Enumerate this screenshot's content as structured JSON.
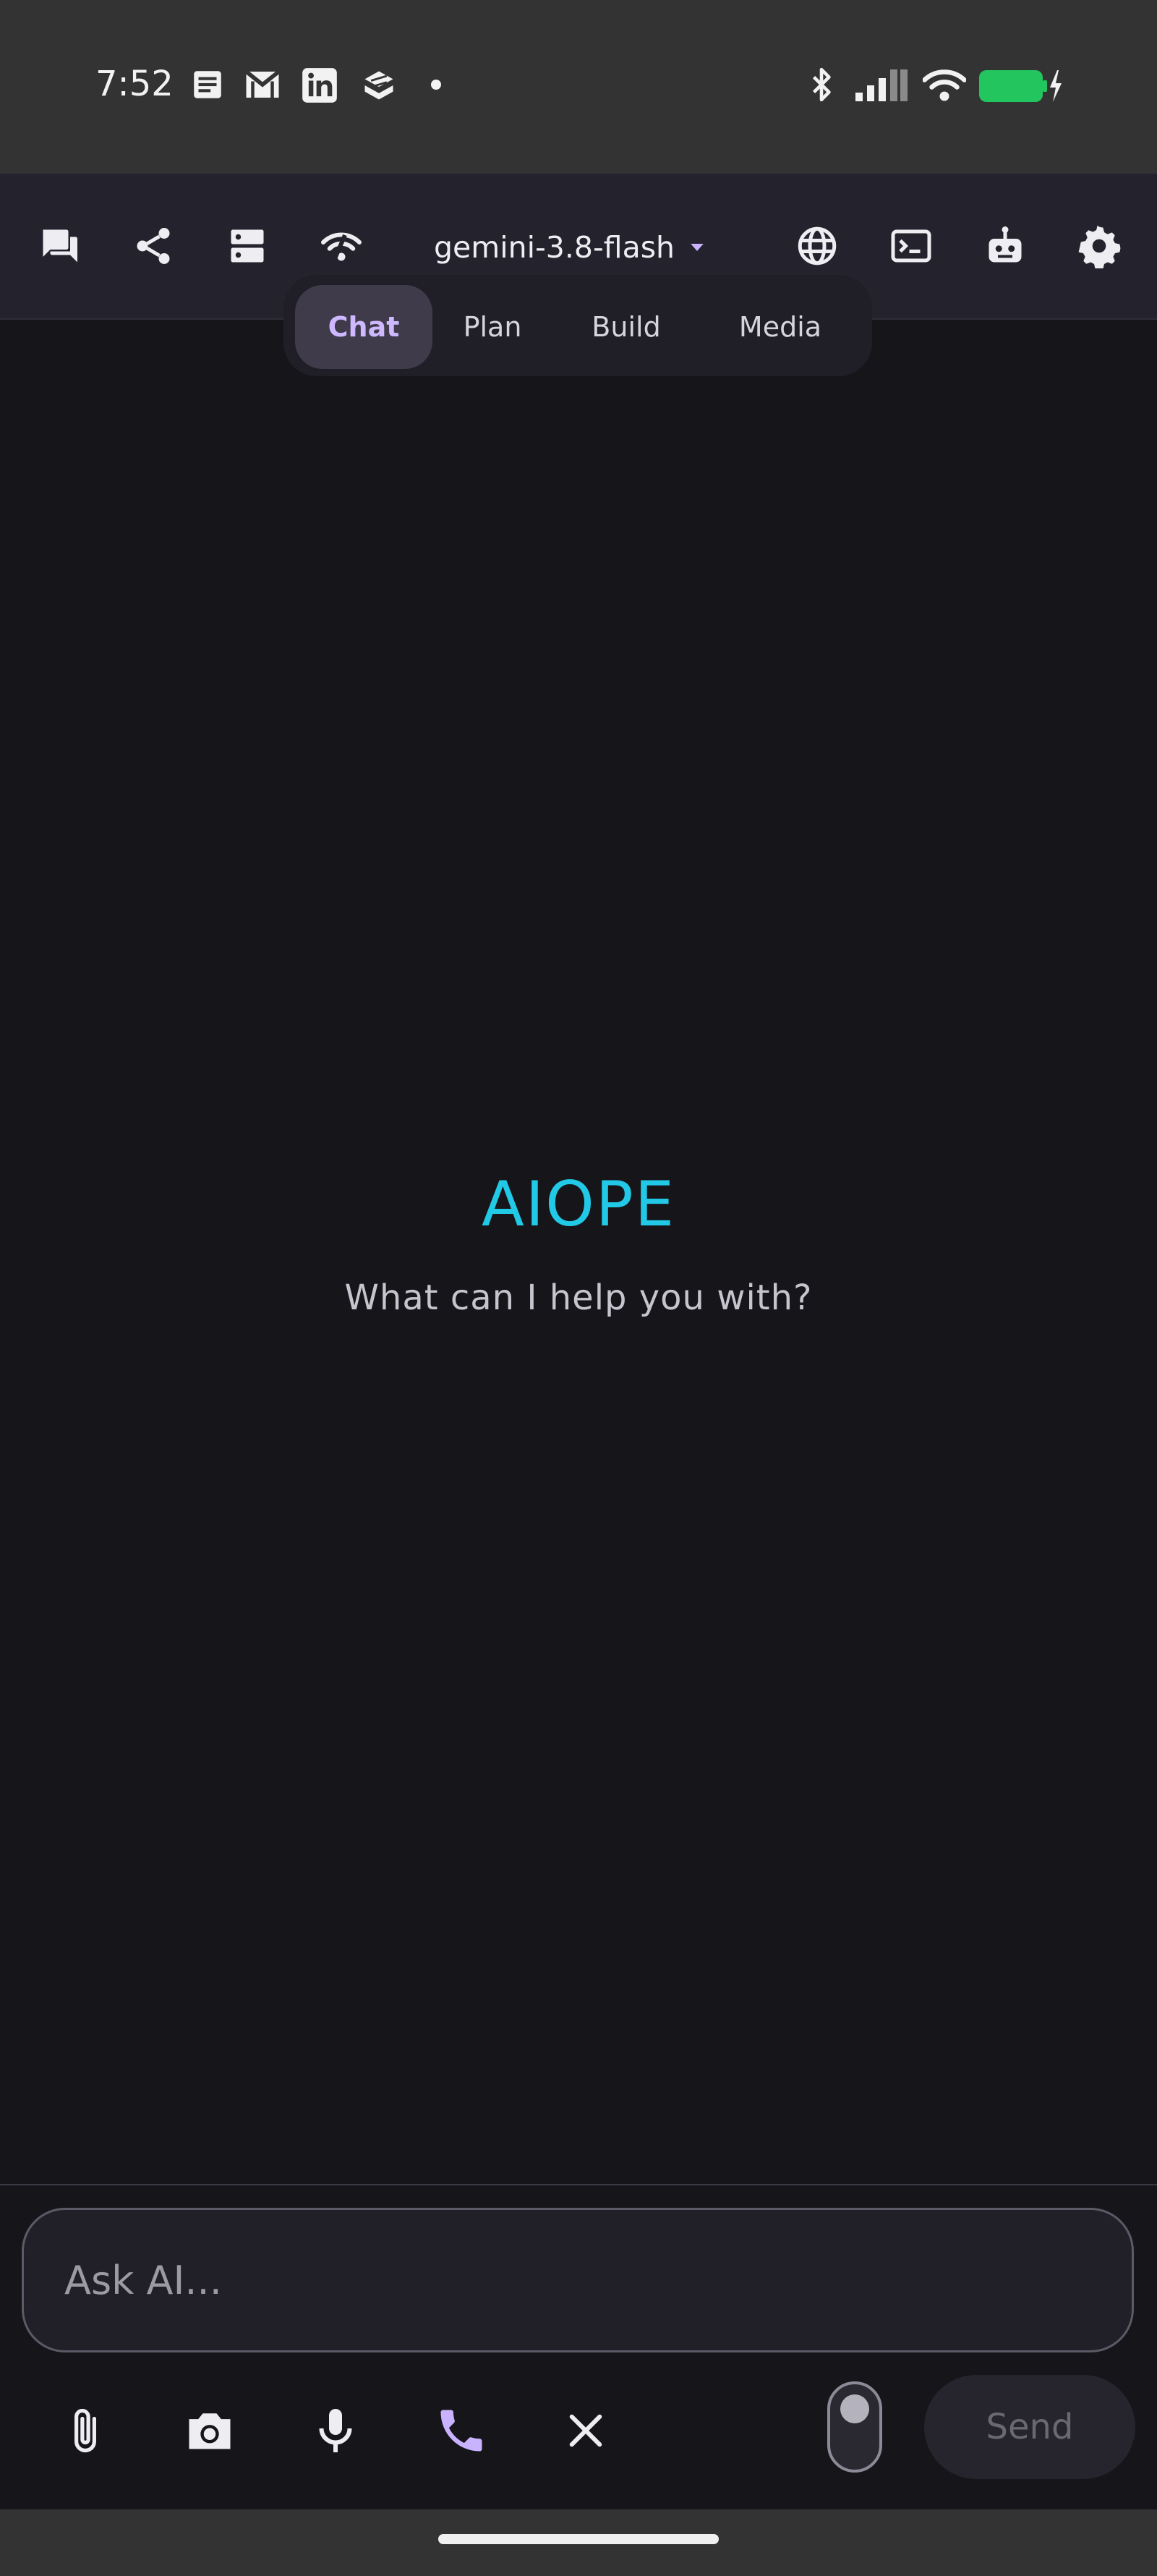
{
  "status_bar": {
    "time": "7:52",
    "notification_icons": [
      "notes-icon",
      "gmail-icon",
      "linkedin-icon",
      "stack-app-icon",
      "dot-icon"
    ],
    "system_icons": [
      "bluetooth-icon",
      "signal-icon",
      "wifi-icon",
      "battery-charging-icon"
    ],
    "battery_color": "#22c55e"
  },
  "toolbar": {
    "left_buttons": [
      "chats-icon",
      "share-icon",
      "servers-icon",
      "connection-icon"
    ],
    "model": "gemini-3.8-flash",
    "right_buttons": [
      "globe-icon",
      "terminal-icon",
      "robot-icon",
      "settings-icon"
    ]
  },
  "modes": {
    "tabs": [
      {
        "label": "Chat",
        "active": true
      },
      {
        "label": "Plan",
        "active": false
      },
      {
        "label": "Build",
        "active": false
      },
      {
        "label": "Media",
        "active": false
      }
    ]
  },
  "hero": {
    "title": "AIOPE",
    "subtitle": "What can I help you with?",
    "title_color": "#22c9e6"
  },
  "composer": {
    "placeholder": "Ask AI...",
    "actions": [
      "attach-icon",
      "camera-icon",
      "microphone-icon",
      "phone-icon",
      "close-icon"
    ],
    "phone_color": "#c9b3ff",
    "send_label": "Send"
  }
}
